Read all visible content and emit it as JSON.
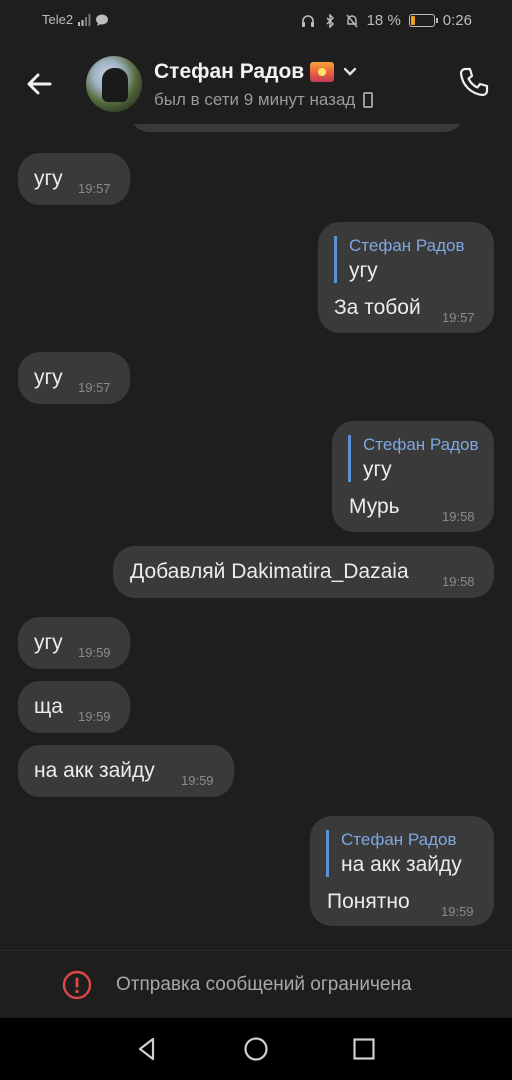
{
  "status_bar": {
    "carrier": "Tele2",
    "battery_percent": "18 %",
    "battery_level": 0.18,
    "time": "0:26",
    "icons": [
      "signal-icon",
      "message-icon",
      "headphones-icon",
      "bluetooth-icon",
      "mute-bell-icon",
      "battery-icon"
    ]
  },
  "header": {
    "contact_name": "Стефан Радов",
    "status": "был в сети 9 минут назад",
    "icons": [
      "back-arrow-icon",
      "sunset-emoji-icon",
      "chevron-down-icon",
      "mobile-phone-icon",
      "call-icon"
    ]
  },
  "messages": [
    {
      "direction": "in",
      "text": "угу",
      "time": "19:57"
    },
    {
      "direction": "out",
      "reply_to_name": "Стефан Радов",
      "reply_to_text": "угу",
      "text": "За тобой",
      "time": "19:57"
    },
    {
      "direction": "in",
      "text": "угу",
      "time": "19:57"
    },
    {
      "direction": "out",
      "reply_to_name": "Стефан Радов",
      "reply_to_text": "угу",
      "text": "Мурь",
      "time": "19:58"
    },
    {
      "direction": "out",
      "text": "Добавляй Dakimatira_Dazaia",
      "time": "19:58"
    },
    {
      "direction": "in",
      "text": "угу",
      "time": "19:59"
    },
    {
      "direction": "in",
      "text": "ща",
      "time": "19:59"
    },
    {
      "direction": "in",
      "text": "на акк зайду",
      "time": "19:59"
    },
    {
      "direction": "out",
      "reply_to_name": "Стефан Радов",
      "reply_to_text": "на акк зайду",
      "text": "Понятно",
      "time": "19:59"
    }
  ],
  "restriction": {
    "text": "Отправка сообщений ограничена",
    "icon": "warning-icon",
    "accent_color": "#e04848"
  },
  "navbar": {
    "icons": [
      "nav-back-icon",
      "nav-home-icon",
      "nav-recents-icon"
    ]
  },
  "colors": {
    "background": "#1e1e1e",
    "bubble": "#3a3a3a",
    "reply_accent": "#5b8fd6",
    "battery": "#f0a020"
  }
}
